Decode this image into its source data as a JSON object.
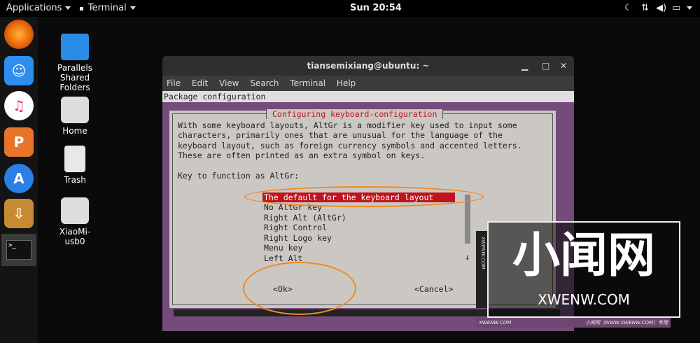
{
  "topbar": {
    "applications": "Applications",
    "terminal": "Terminal",
    "clock": "Sun 20:54"
  },
  "desktop": {
    "icons": [
      {
        "label": "Parallels\nShared\nFolders"
      },
      {
        "label": "Home"
      },
      {
        "label": "Trash"
      },
      {
        "label": "XiaoMi-\nusb0"
      }
    ]
  },
  "window": {
    "title": "tiansemixiang@ubuntu: ~",
    "menu": [
      "File",
      "Edit",
      "View",
      "Search",
      "Terminal",
      "Help"
    ]
  },
  "dialog": {
    "package_bar": "Package configuration",
    "title": "Configuring keyboard-configuration",
    "description": "With some keyboard layouts, AltGr is a modifier key used to input some\ncharacters, primarily ones that are unusual for the language of the\nkeyboard layout, such as foreign currency symbols and accented letters.\nThese are often printed as an extra symbol on keys.",
    "prompt": "Key to function as AltGr:",
    "options": [
      "The default for the keyboard layout",
      "No AltGr key",
      "Right Alt (AltGr)",
      "Right Control",
      "Right Logo key",
      "Menu key",
      "Left Alt"
    ],
    "selected_index": 0,
    "ok": "<Ok>",
    "cancel": "<Cancel>"
  },
  "watermark": {
    "big": "小闻网",
    "url": "XWENW.COM",
    "side": "XWENW.COM",
    "footer_left": "XWENW.COM",
    "footer_right": "小闻网（WWW.XWENW.COM）专用"
  },
  "colors": {
    "selection": "#c0141c",
    "annotation": "#f08a24",
    "terminal_bg": "#744b7a"
  }
}
